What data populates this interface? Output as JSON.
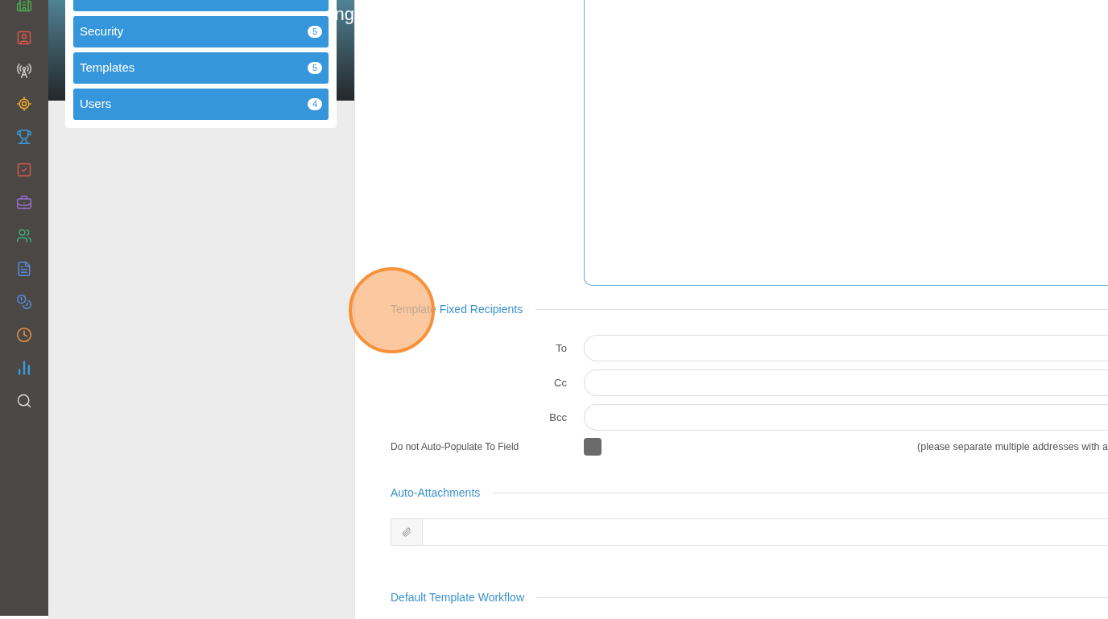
{
  "rail": [
    {
      "kind": "building",
      "color": "#4caf50"
    },
    {
      "kind": "contact",
      "color": "#e0574a"
    },
    {
      "kind": "antenna",
      "color": "#cfcfcf"
    },
    {
      "kind": "target",
      "color": "#f0a830"
    },
    {
      "kind": "trophy",
      "color": "#3a9bd5"
    },
    {
      "kind": "task",
      "color": "#e0574a"
    },
    {
      "kind": "briefcase",
      "color": "#9b6fd6"
    },
    {
      "kind": "users",
      "color": "#3bb07a"
    },
    {
      "kind": "document",
      "color": "#5b8ee0"
    },
    {
      "kind": "coins",
      "color": "#5b8ee0"
    },
    {
      "kind": "clock",
      "color": "#e8954a"
    },
    {
      "kind": "chart",
      "color": "#3a9bd5"
    },
    {
      "kind": "search",
      "color": "#d8d8d8"
    }
  ],
  "header": {
    "title": "ng"
  },
  "menu": [
    {
      "label": "Security",
      "count": "5"
    },
    {
      "label": "Templates",
      "count": "5"
    },
    {
      "label": "Users",
      "count": "4"
    }
  ],
  "recipients": {
    "heading": "Template Fixed Recipients",
    "fields": [
      {
        "label": "To"
      },
      {
        "label": "Cc"
      },
      {
        "label": "Bcc"
      }
    ],
    "auto_populate": {
      "label": "Do not Auto-Populate To Field",
      "checked": false
    },
    "hint": "(please separate multiple addresses with a"
  },
  "attachments": {
    "heading": "Auto-Attachments"
  },
  "workflow": {
    "heading": "Default Template Workflow"
  }
}
